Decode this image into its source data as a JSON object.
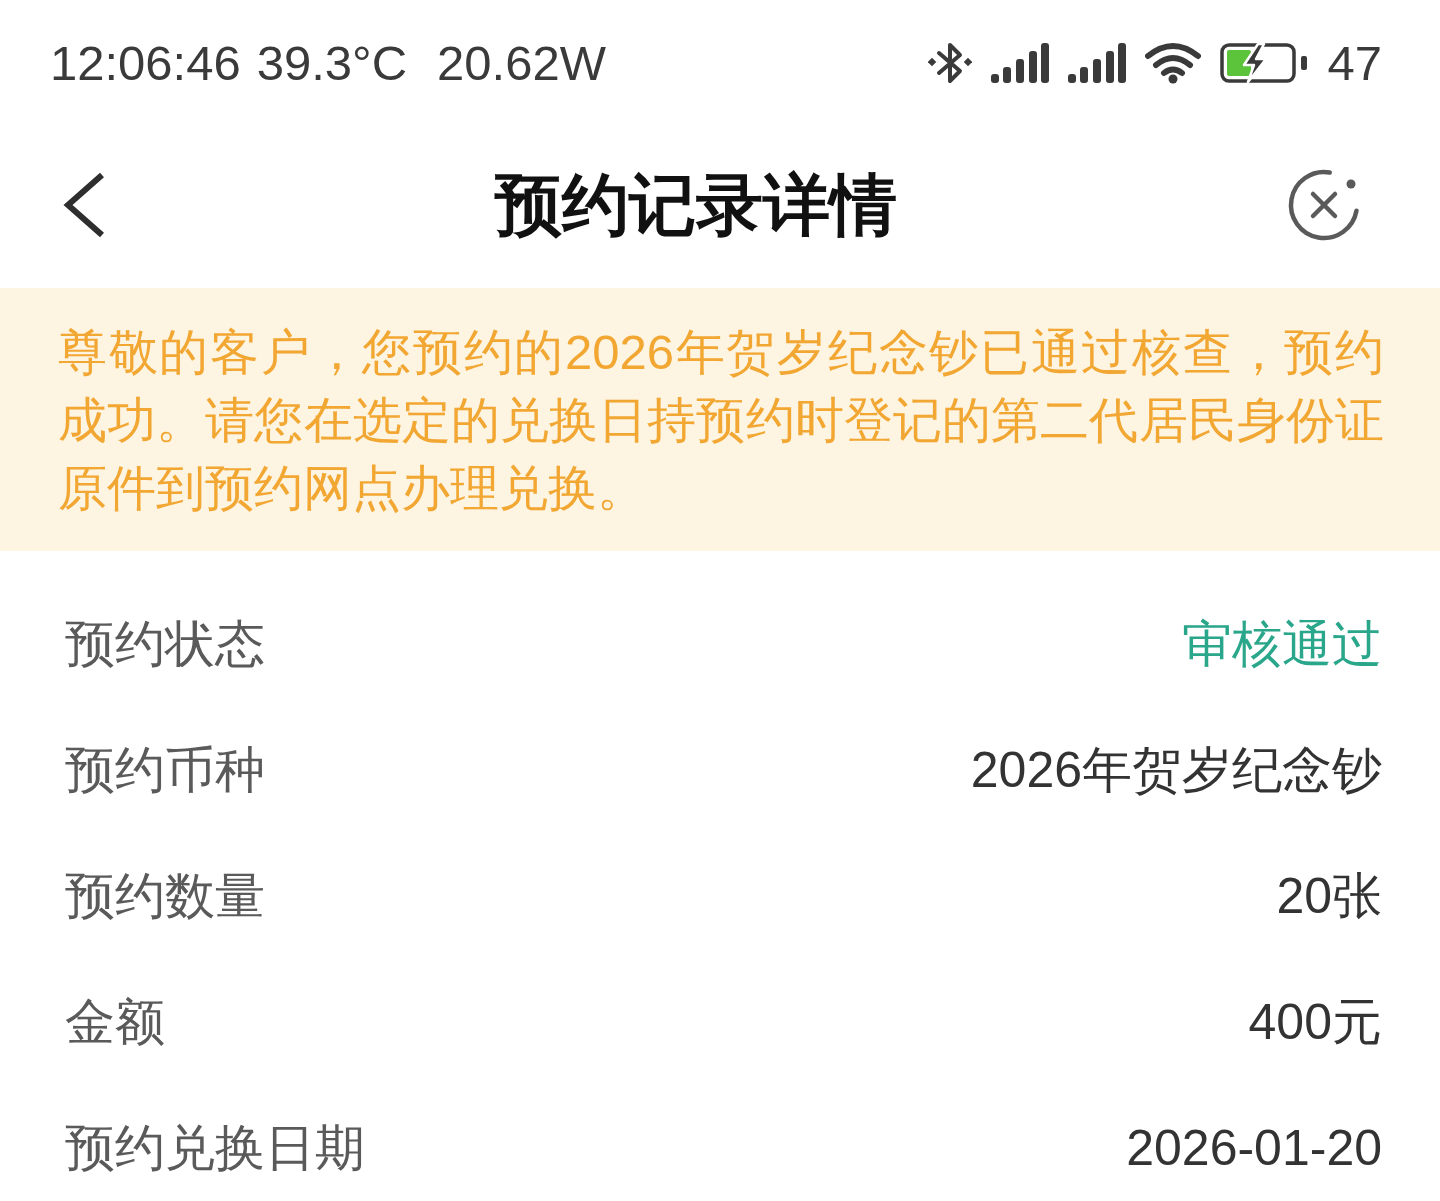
{
  "status_bar": {
    "time": "12:06:46",
    "temperature": "39.3°C",
    "power": "20.62W",
    "battery_percent": "47"
  },
  "header": {
    "title": "预约记录详情"
  },
  "notice": {
    "text": "尊敬的客户，您预约的2026年贺岁纪念钞已通过核查，预约成功。请您在选定的兑换日持预约时登记的第二代居民身份证原件到预约网点办理兑换。"
  },
  "details": [
    {
      "label": "预约状态",
      "value": "审核通过",
      "kind": "status"
    },
    {
      "label": "预约币种",
      "value": "2026年贺岁纪念钞",
      "kind": "text"
    },
    {
      "label": "预约数量",
      "value": "20张",
      "kind": "text"
    },
    {
      "label": "金额",
      "value": "400元",
      "kind": "text"
    },
    {
      "label": "预约兑换日期",
      "value": "2026-01-20",
      "kind": "text"
    }
  ]
}
